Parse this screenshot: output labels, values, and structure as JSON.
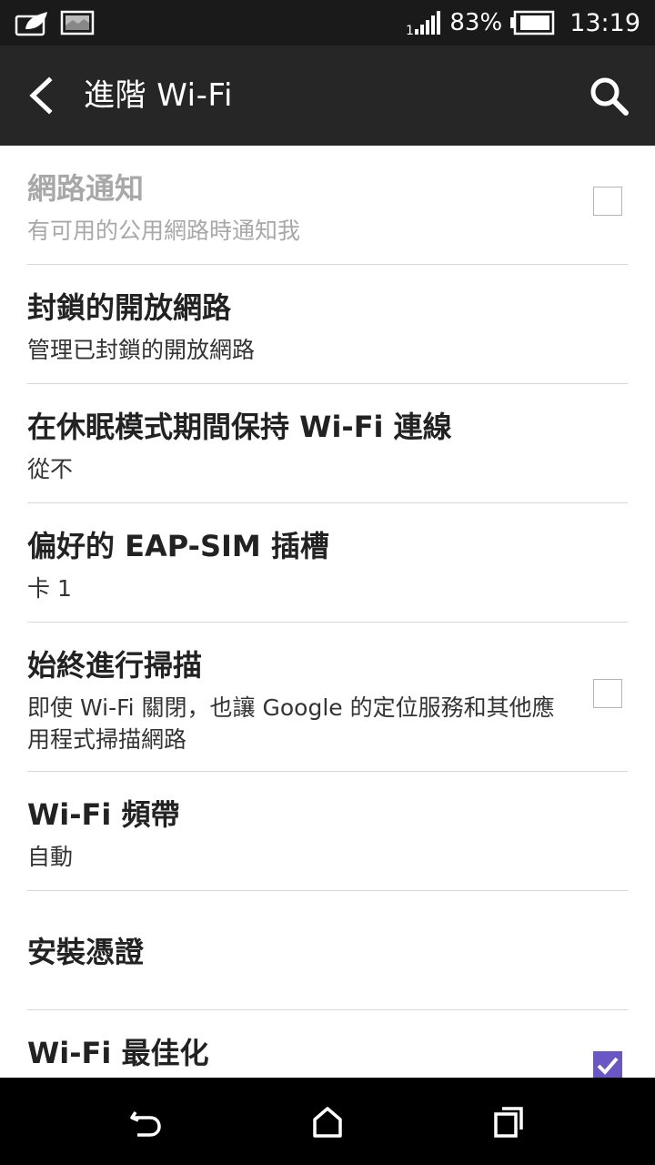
{
  "status_bar": {
    "battery_percent": "83%",
    "time": "13:19",
    "icons": [
      "app-notification-icon",
      "image-notification-icon",
      "signal-icon",
      "battery-icon"
    ]
  },
  "action_bar": {
    "title": "進階 Wi-Fi",
    "icons": [
      "back-arrow-icon",
      "search-icon"
    ]
  },
  "settings": {
    "items": [
      {
        "title": "網路通知",
        "summary": "有可用的公用網路時通知我",
        "checkbox": false,
        "disabled": true
      },
      {
        "title": "封鎖的開放網路",
        "summary": "管理已封鎖的開放網路"
      },
      {
        "title": "在休眠模式期間保持 Wi-Fi 連線",
        "summary": "從不"
      },
      {
        "title": "偏好的 EAP-SIM 插槽",
        "summary": "卡 1"
      },
      {
        "title": "始終進行掃描",
        "summary": "即使 Wi-Fi 關閉，也讓 Google 的定位服務和其他應用程式掃描網路",
        "checkbox": false
      },
      {
        "title": "Wi-Fi 頻帶",
        "summary": "自動"
      },
      {
        "title": "安裝憑證",
        "summary": ""
      },
      {
        "title": "Wi-Fi 最佳化",
        "summary": "",
        "checkbox": true
      }
    ]
  },
  "nav_bar": {
    "icons": [
      "back-icon",
      "home-icon",
      "recent-apps-icon"
    ]
  },
  "colors": {
    "status_bar_bg": "#1a1a1a",
    "action_bar_bg": "#262626",
    "checkbox_checked": "#6a56c4",
    "divider": "#d8d8d8"
  }
}
